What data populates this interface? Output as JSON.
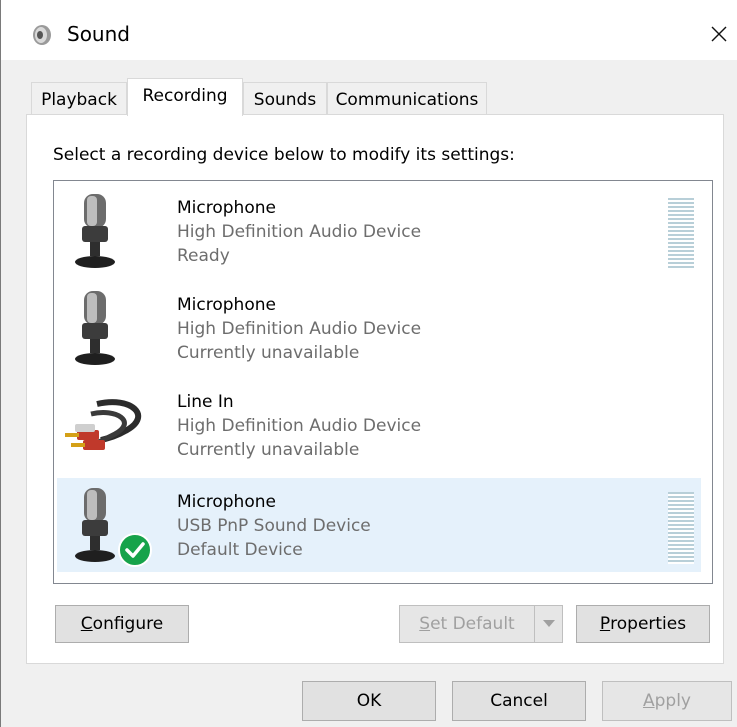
{
  "window": {
    "title": "Sound",
    "close_glyph": "✕",
    "icon": "speaker-icon"
  },
  "tabs": [
    {
      "label": "Playback",
      "active": false
    },
    {
      "label": "Recording",
      "active": true
    },
    {
      "label": "Sounds",
      "active": false
    },
    {
      "label": "Communications",
      "active": false
    }
  ],
  "instruction": "Select a recording device below to modify its settings:",
  "devices": [
    {
      "name": "Microphone",
      "description": "High Definition Audio Device",
      "status": "Ready",
      "icon": "microphone-icon",
      "selected": false,
      "default": false,
      "has_meter": true
    },
    {
      "name": "Microphone",
      "description": "High Definition Audio Device",
      "status": "Currently unavailable",
      "icon": "microphone-icon",
      "selected": false,
      "default": false,
      "has_meter": false
    },
    {
      "name": "Line In",
      "description": "High Definition Audio Device",
      "status": "Currently unavailable",
      "icon": "line-in-cable-icon",
      "selected": false,
      "default": false,
      "has_meter": false
    },
    {
      "name": "Microphone",
      "description": "USB PnP Sound Device",
      "status": "Default Device",
      "icon": "microphone-icon",
      "selected": true,
      "default": true,
      "has_meter": true
    }
  ],
  "buttons": {
    "configure": {
      "prefix": "",
      "accel": "C",
      "rest": "onfigure"
    },
    "set_default": {
      "prefix": "",
      "accel": "S",
      "rest": "et Default",
      "enabled": false
    },
    "properties": {
      "prefix": "",
      "accel": "P",
      "rest": "roperties"
    },
    "ok": "OK",
    "cancel": "Cancel",
    "apply": {
      "prefix": "",
      "accel": "A",
      "rest": "pply",
      "enabled": false
    }
  },
  "colors": {
    "selected_row": "#e5f1fb",
    "default_check": "#16a34a",
    "secondary_text": "#6d6d6d"
  }
}
